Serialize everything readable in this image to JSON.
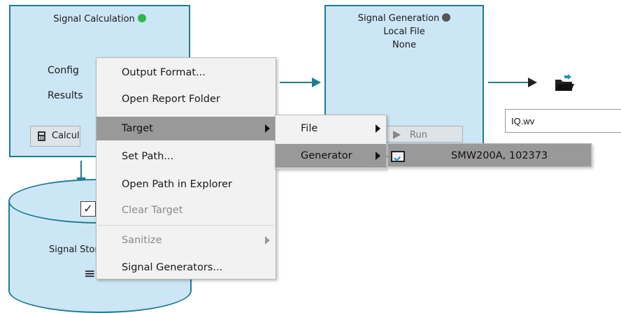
{
  "signal_calculation": {
    "title": "Signal Calculation",
    "status_color": "#2db84a",
    "config_label": "Config",
    "results_label": "Results",
    "calc_button_label": "Calculate"
  },
  "signal_generation": {
    "title": "Signal Generation",
    "line2": "Local File",
    "line3": "None",
    "status_color": "#555555",
    "run_label": "Run"
  },
  "signal_storage": {
    "label": "Signal Storage",
    "checkbox_checked": true
  },
  "output": {
    "filename": "IQ.wv"
  },
  "context_menu": {
    "items": [
      {
        "label": "Output Format...",
        "enabled": true
      },
      {
        "label": "Open Report Folder",
        "enabled": true
      },
      {
        "label": "Target",
        "enabled": true,
        "submenu": true,
        "highlighted": true
      },
      {
        "label": "Set Path...",
        "enabled": true
      },
      {
        "label": "Open Path in Explorer",
        "enabled": true
      },
      {
        "label": "Clear Target",
        "enabled": false
      },
      {
        "label": "Sanitize",
        "enabled": false,
        "submenu": true
      },
      {
        "label": "Signal Generators...",
        "enabled": true
      }
    ]
  },
  "target_submenu": {
    "items": [
      {
        "label": "File",
        "submenu": true
      },
      {
        "label": "Generator",
        "submenu": true,
        "highlighted": true
      }
    ]
  },
  "generator_submenu": {
    "items": [
      {
        "label": "SMW200A, 102373",
        "icon": "generator-icon"
      }
    ]
  },
  "colors": {
    "block_fill": "#cde6f6",
    "block_border": "#1e7d91",
    "menu_bg": "#f2f2f2",
    "menu_highlight": "#999999"
  }
}
